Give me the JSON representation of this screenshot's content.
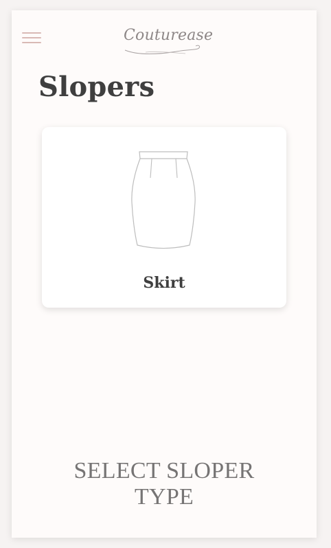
{
  "header": {
    "menu_icon": "hamburger-menu-icon",
    "logo_text": "Couturease"
  },
  "page": {
    "title": "Slopers"
  },
  "sloper_cards": [
    {
      "label": "Skirt",
      "icon": "skirt-icon"
    }
  ],
  "footer": {
    "caption": "SELECT SLOPER TYPE"
  },
  "colors": {
    "menu_icon": "#d9b9b5",
    "title_text": "#3f3f3f",
    "caption_text": "#767474",
    "background": "#fefbfa"
  }
}
